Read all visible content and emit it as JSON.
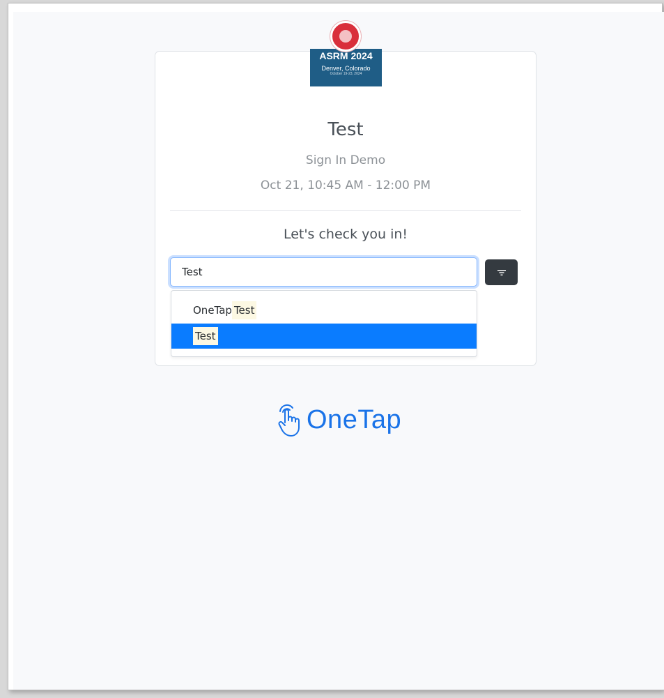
{
  "event_logo": {
    "title": "ASRM 2024",
    "location": "Denver, Colorado",
    "dates": "October 19-23, 2024"
  },
  "session": {
    "title": "Test",
    "subtitle": "Sign In Demo",
    "datetime": "Oct 21, 10:45 AM - 12:00 PM"
  },
  "checkin": {
    "prompt": "Let's check you in!",
    "search_value": "Test",
    "filter_icon": "filter-icon"
  },
  "dropdown": {
    "items": [
      {
        "prefix": "OneTap ",
        "match": "Test",
        "selected": false
      },
      {
        "prefix": "",
        "match": "Test",
        "selected": true
      }
    ]
  },
  "footer": {
    "brand": "OneTap",
    "brand_icon": "tap-hand-icon"
  },
  "colors": {
    "accent": "#0a7cff",
    "brand": "#1a73e8",
    "button_dark": "#343a40",
    "highlight": "#fcf8e3"
  }
}
